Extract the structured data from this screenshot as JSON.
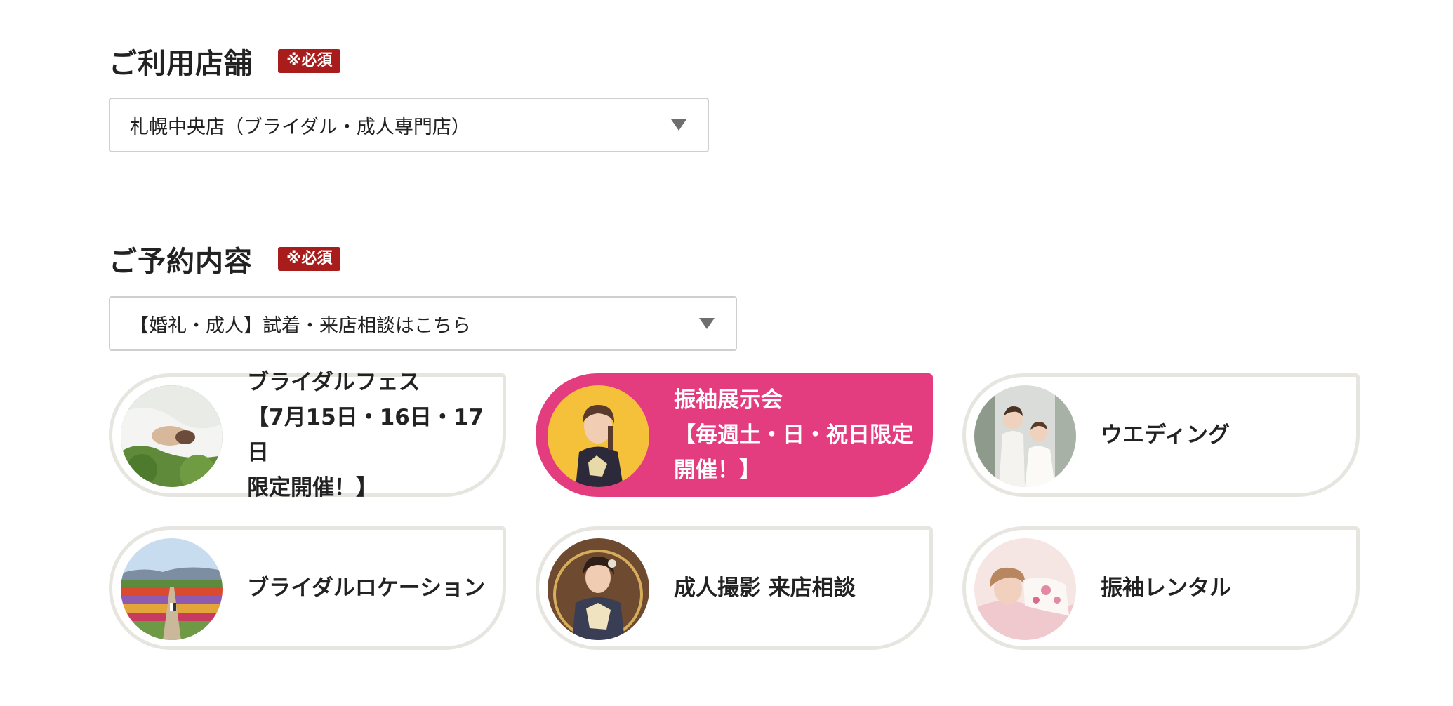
{
  "store_section": {
    "title": "ご利用店舗",
    "required_badge": "※必須",
    "select_value": "札幌中央店（ブライダル・成人専門店）"
  },
  "booking_section": {
    "title": "ご予約内容",
    "required_badge": "※必須",
    "select_value": "【婚礼・成人】試着・来店相談はこちら"
  },
  "options": [
    {
      "label": "ブライダルフェス\n【7月15日・16日・17日\n限定開催！】",
      "image": "bride-lying-on-grass-photo",
      "selected": false
    },
    {
      "label": "振袖展示会\n【毎週土・日・祝日限定\n開催！】",
      "image": "furisode-model-photo",
      "selected": true
    },
    {
      "label": "ウエディング",
      "image": "wedding-couple-photo",
      "selected": false
    },
    {
      "label": "ブライダルロケーション",
      "image": "flower-field-location-photo",
      "selected": false
    },
    {
      "label": "成人撮影 来店相談",
      "image": "coming-of-age-portrait-photo",
      "selected": false
    },
    {
      "label": "振袖レンタル",
      "image": "furisode-rental-photo",
      "selected": false
    }
  ],
  "colors": {
    "required_badge": "#a81c1c",
    "selected_card": "#e33d7f",
    "card_border": "#e6e5e0"
  }
}
